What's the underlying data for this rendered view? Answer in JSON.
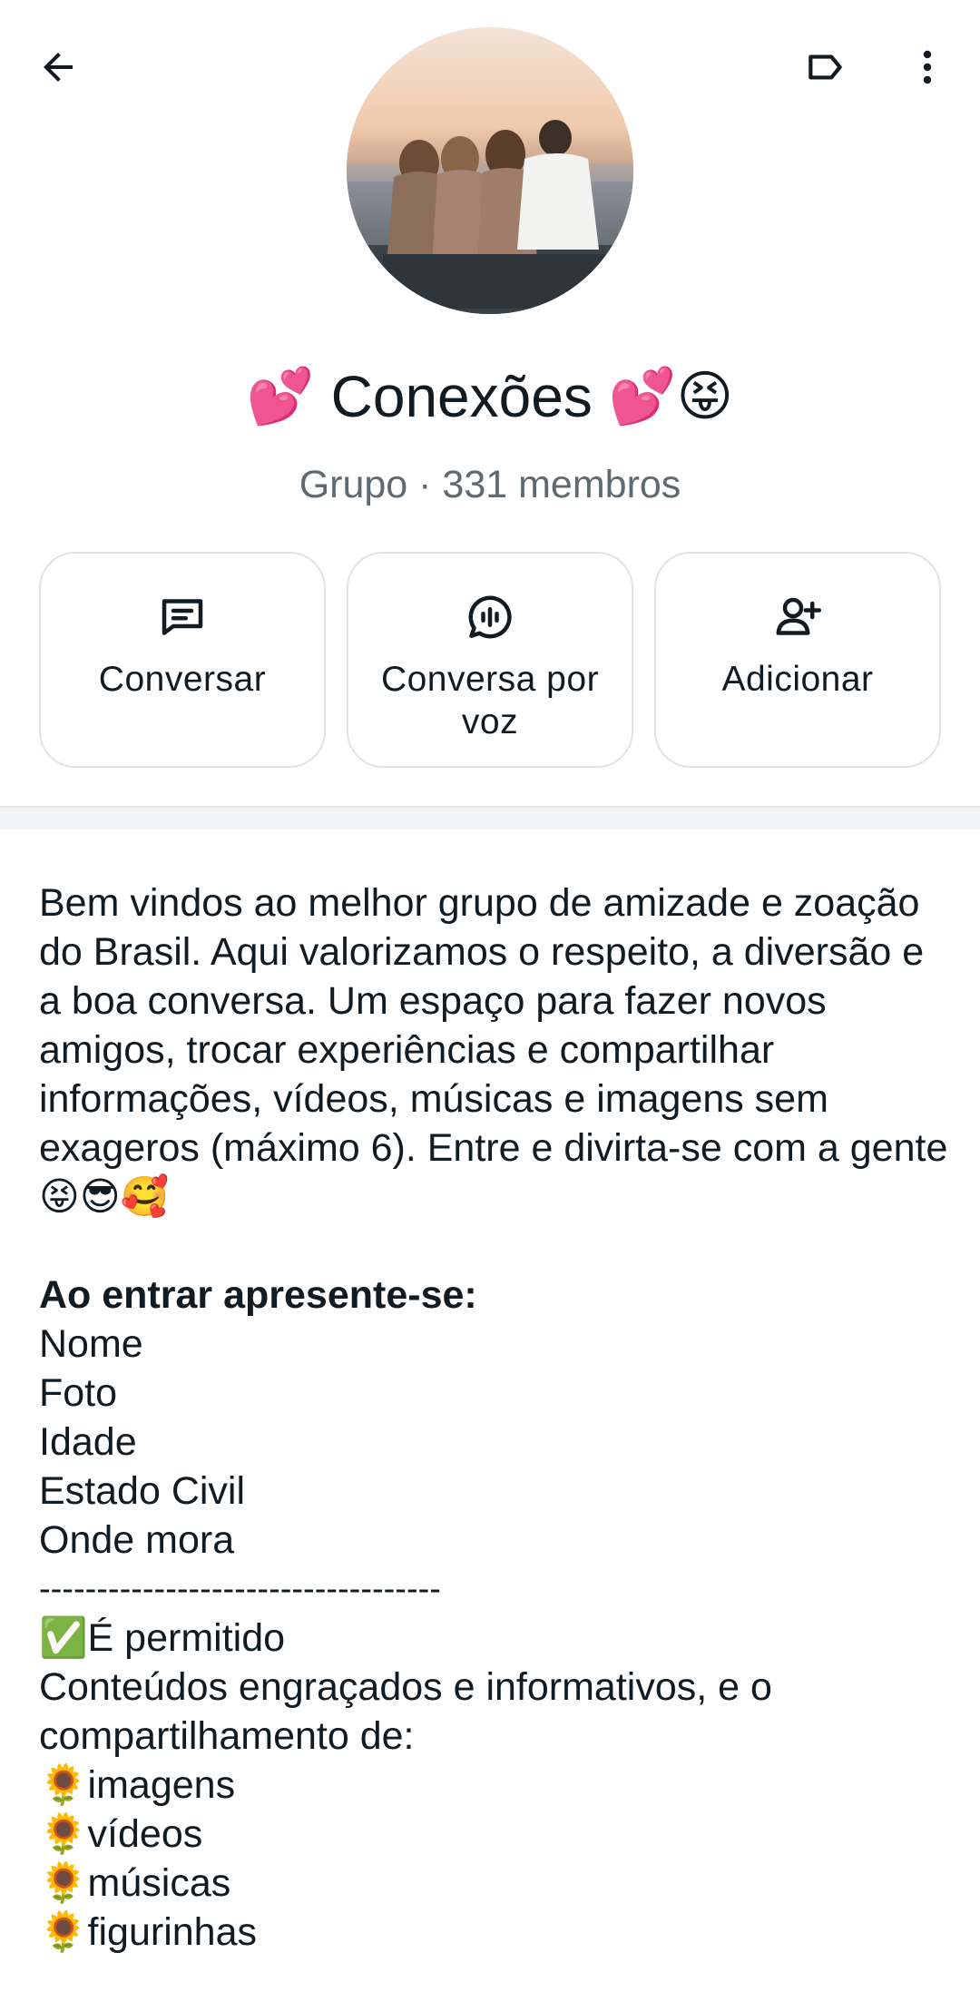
{
  "header": {
    "back_icon": "arrow-left-icon",
    "label_icon": "label-tag-icon",
    "more_icon": "more-vertical-icon"
  },
  "group": {
    "title": "Conexões",
    "title_emoji_left": "💕",
    "title_emoji_right": "💕😝",
    "subtitle": "Grupo · 331 membros"
  },
  "actions": [
    {
      "label": "Conversar",
      "icon": "chat-icon"
    },
    {
      "label": "Conversa por voz",
      "icon": "voice-chat-icon"
    },
    {
      "label": "Adicionar",
      "icon": "add-person-icon"
    }
  ],
  "description": {
    "intro": "Bem vindos ao melhor grupo de amizade e zoação do Brasil. Aqui valorizamos o respeito, a diversão e a boa conversa. Um espaço  para fazer novos amigos, trocar experiências e compartilhar informações, vídeos, músicas e imagens sem exageros (máximo 6). Entre e divirta-se com a gente😝😎🥰",
    "heading": "Ao entrar apresente-se:",
    "fields": [
      "Nome",
      "Foto",
      "Idade",
      "Estado Civil",
      "Onde mora"
    ],
    "divider": "-----------------------------------",
    "allowed_title": "✅É permitido",
    "allowed_text": "Conteúdos engraçados e informativos, e o compartilhamento de:",
    "allowed_items": [
      "🌻imagens",
      "🌻vídeos",
      "🌻músicas",
      "🌻figurinhas"
    ]
  }
}
